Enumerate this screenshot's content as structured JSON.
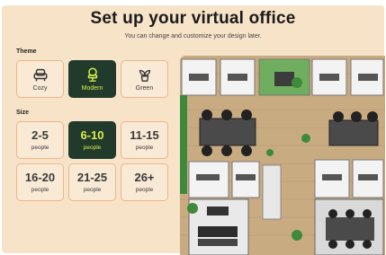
{
  "header": {
    "title": "Set up your virtual office",
    "subtitle": "You can change and customize your design later."
  },
  "theme": {
    "label": "Theme",
    "options": [
      {
        "label": "Cozy",
        "icon": "armchair-icon",
        "selected": false
      },
      {
        "label": "Modern",
        "icon": "office-chair-icon",
        "selected": true
      },
      {
        "label": "Green",
        "icon": "plant-icon",
        "selected": false
      }
    ]
  },
  "size": {
    "label": "Size",
    "options": [
      {
        "range": "2-5",
        "unit": "people",
        "selected": false
      },
      {
        "range": "6-10",
        "unit": "people",
        "selected": true
      },
      {
        "range": "11-15",
        "unit": "people",
        "selected": false
      },
      {
        "range": "16-20",
        "unit": "people",
        "selected": false
      },
      {
        "range": "21-25",
        "unit": "people",
        "selected": false
      },
      {
        "range": "26+",
        "unit": "people",
        "selected": false
      }
    ]
  },
  "colors": {
    "panel_bg": "#f7e3c8",
    "card_border": "#f0b489",
    "selected_bg": "#213a2c",
    "selected_text": "#d9ef4a"
  }
}
